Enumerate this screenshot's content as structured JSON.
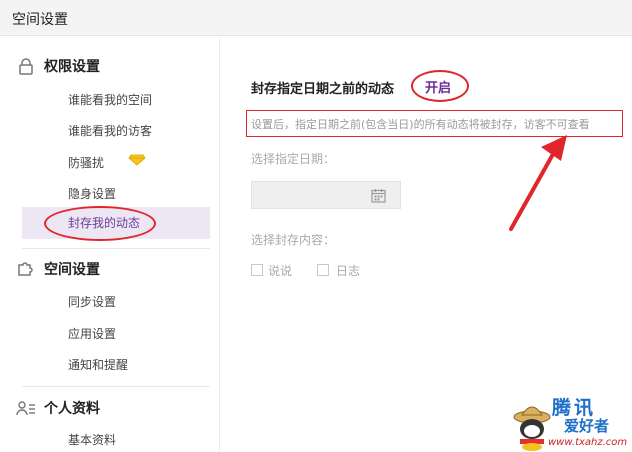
{
  "window": {
    "title": "空间设置"
  },
  "sidebar": {
    "permissions": {
      "title": "权限设置",
      "icon": "lock-icon",
      "items": [
        {
          "label": "谁能看我的空间"
        },
        {
          "label": "谁能看我的访客"
        },
        {
          "label": "防骚扰"
        },
        {
          "label": "隐身设置",
          "badge_icon": "diamond-icon",
          "badge_color": "#f2c200"
        },
        {
          "label": "封存我的动态",
          "selected": true
        }
      ]
    },
    "space": {
      "title": "空间设置",
      "icon": "puzzle-icon",
      "items": [
        {
          "label": "同步设置"
        },
        {
          "label": "应用设置"
        },
        {
          "label": "通知和提醒"
        }
      ]
    },
    "profile": {
      "title": "个人资料",
      "icon": "person-list-icon",
      "items": [
        {
          "label": "基本资料"
        }
      ]
    }
  },
  "main": {
    "feature_title": "封存指定日期之前的动态",
    "toggle_label": "开启",
    "description": "设置后，指定日期之前(包含当日)的所有动态将被封存，访客不可查看",
    "date_label": "选择指定日期：",
    "date_value": "",
    "content_label": "选择封存内容：",
    "options": [
      {
        "label": "说说",
        "checked": false
      },
      {
        "label": "日志",
        "checked": false
      }
    ]
  },
  "watermark": {
    "brand_line1": "腾讯",
    "brand_line2": "爱好者",
    "url": "www.txahz.com"
  },
  "colors": {
    "accent": "#6a2a9a",
    "annotation_red": "#e0262a",
    "selected_bg": "#ece7f3"
  }
}
